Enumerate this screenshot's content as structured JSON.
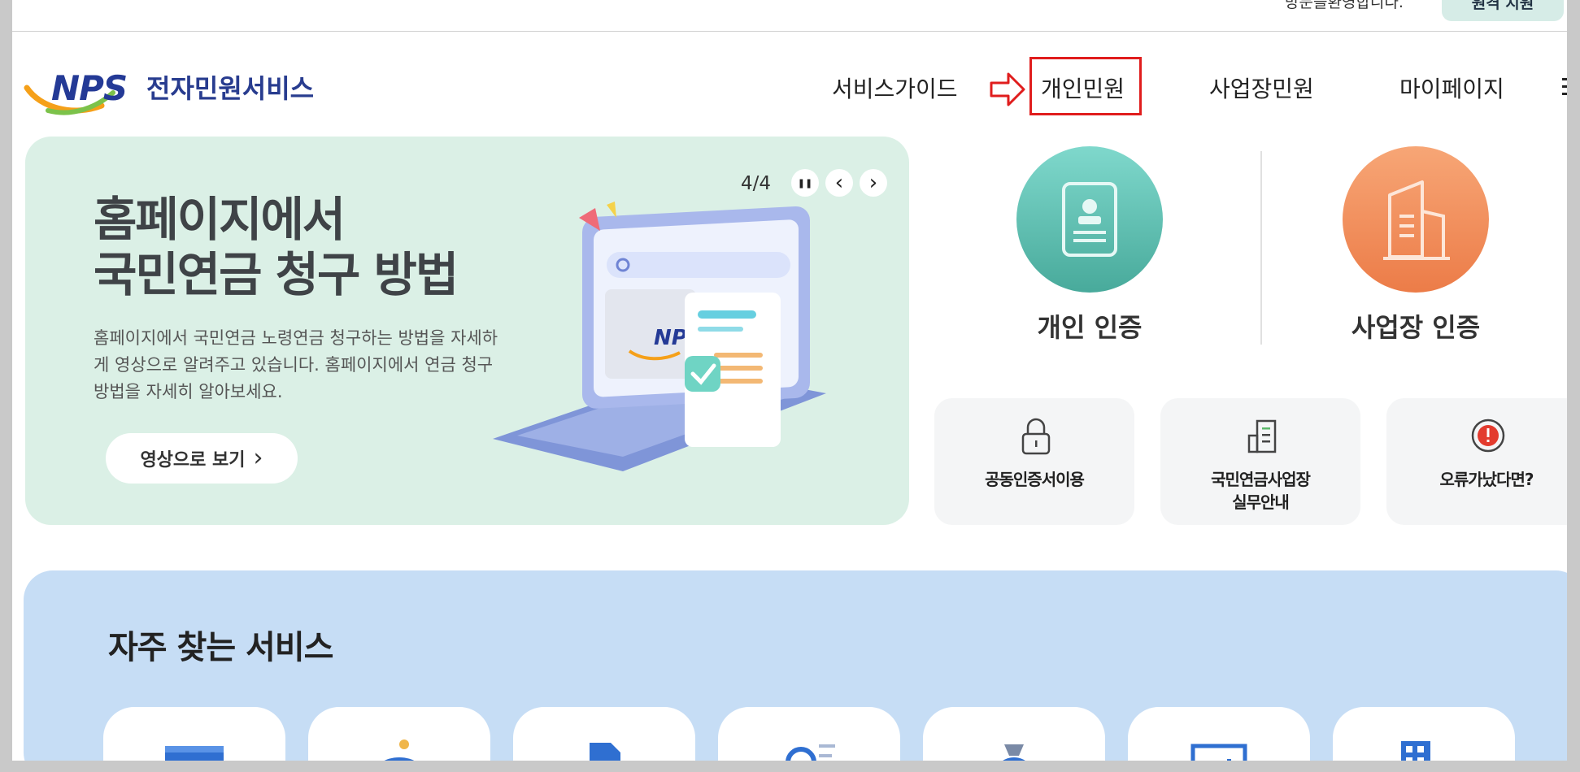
{
  "header": {
    "welcome": "방문을환영합니다.",
    "top_button": "원격 지원",
    "logo_text": "NPS",
    "site_name": "전자민원서비스"
  },
  "nav": {
    "items": [
      {
        "label": "서비스가이드"
      },
      {
        "label": "개인민원"
      },
      {
        "label": "사업장민원"
      },
      {
        "label": "마이페이지"
      }
    ]
  },
  "banner": {
    "title_line1": "홈페이지에서",
    "title_line2": "국민연금 청구 방법",
    "description": "홈페이지에서 국민연금 노령연금 청구하는 방법을 자세하게 영상으로 알려주고 있습니다. 홈페이지에서 연금 청구방법을 자세히 알아보세요.",
    "button_label": "영상으로 보기",
    "button_arrow": "›",
    "counter": "4/4",
    "pause_glyph": "❚❚",
    "prev_glyph": "‹",
    "next_glyph": "›",
    "laptop_logo": "NPS"
  },
  "auth": {
    "personal_label": "개인 인증",
    "business_label": "사업장 인증",
    "personal_color": "#5bc0b0",
    "business_color": "#f28a55"
  },
  "quick_links": [
    {
      "label": "공동인증서이용",
      "icon": "lock-icon"
    },
    {
      "label": "국민연금사업장\n실무안내",
      "icon": "document-building-icon"
    },
    {
      "label": "오류가났다면?",
      "icon": "alert-icon"
    }
  ],
  "frequent": {
    "title": "자주 찾는 서비스",
    "icons": [
      "won-card-icon",
      "piggy-bank-icon",
      "document-list-icon",
      "search-list-icon",
      "money-bag-icon",
      "chart-icon",
      "building-icon"
    ]
  },
  "colors": {
    "highlight": "#e01d1d",
    "banner_bg": "#dbf0e6",
    "frequent_bg": "#c6ddf5",
    "brand": "#243a96"
  }
}
